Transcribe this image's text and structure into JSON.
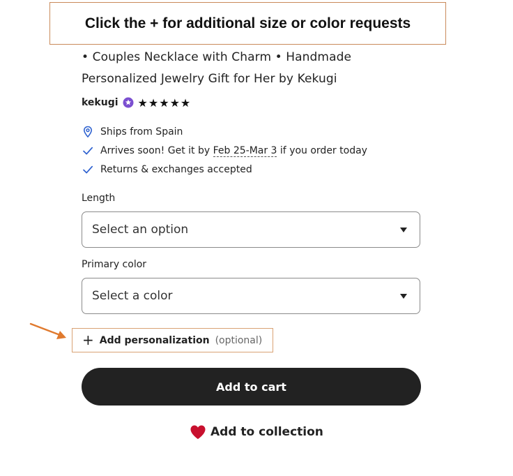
{
  "callout": {
    "text": "Click the + for additional size or color requests"
  },
  "listing": {
    "title_line_1": "• Couples Necklace with Charm • Handmade",
    "title_line_2": "Personalized Jewelry Gift for Her by Kekugi",
    "shop_name": "kekugi",
    "stars": "★★★★★",
    "rating_stars": 5
  },
  "shipping": {
    "ships_from": "Ships from Spain",
    "arrives_prefix": "Arrives soon! Get it by ",
    "arrives_dates": "Feb 25-Mar 3",
    "arrives_suffix": " if you order today",
    "returns": "Returns & exchanges accepted"
  },
  "options": {
    "length_label": "Length",
    "length_value": "Select an option",
    "color_label": "Primary color",
    "color_value": "Select a color"
  },
  "personalization": {
    "label": "Add personalization",
    "optional": "(optional)"
  },
  "actions": {
    "add_to_cart": "Add to cart",
    "add_to_collection": "Add to collection"
  },
  "colors": {
    "annotation_border": "#c98a5a",
    "arrow": "#e07a2e",
    "star_seller_badge": "#7b4fd0",
    "check_blue": "#2f62d0",
    "cart_button": "#222222",
    "heart": "#c8102e"
  },
  "icons": {
    "location": "map-pin-icon",
    "check": "checkmark-icon",
    "caret": "caret-down-icon",
    "plus": "plus-icon",
    "heart": "heart-icon",
    "star_seller": "star-seller-badge-icon",
    "arrow": "annotation-arrow-icon"
  }
}
